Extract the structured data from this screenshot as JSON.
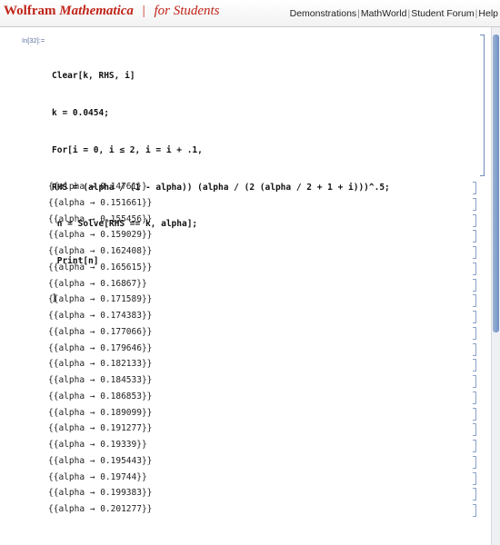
{
  "header": {
    "brand_wolfram": "Wolfram",
    "brand_mathematica": "Mathematica",
    "brand_divider": "|",
    "brand_students": "for Students",
    "links": [
      "Demonstrations",
      "MathWorld",
      "Student Forum",
      "Help"
    ]
  },
  "notebook": {
    "input_label": "In[32]:=",
    "code_lines": [
      "Clear[k, RHS, i]",
      "k = 0.0454;",
      "For[i = 0, i ≤ 2, i = i + .1,",
      "RHS = (alpha / (1 - alpha)) (alpha / (2 (alpha / 2 + 1 + i)))^.5;",
      " n = Solve[RHS == k, alpha];",
      " Print[n]",
      "]"
    ],
    "outputs": [
      "{{alpha → 0.14761}}",
      "{{alpha → 0.151661}}",
      "{{alpha → 0.155456}}",
      "{{alpha → 0.159029}}",
      "{{alpha → 0.162408}}",
      "{{alpha → 0.165615}}",
      "{{alpha → 0.16867}}",
      "{{alpha → 0.171589}}",
      "{{alpha → 0.174383}}",
      "{{alpha → 0.177066}}",
      "{{alpha → 0.179646}}",
      "{{alpha → 0.182133}}",
      "{{alpha → 0.184533}}",
      "{{alpha → 0.186853}}",
      "{{alpha → 0.189099}}",
      "{{alpha → 0.191277}}",
      "{{alpha → 0.19339}}",
      "{{alpha → 0.195443}}",
      "{{alpha → 0.19744}}",
      "{{alpha → 0.199383}}",
      "{{alpha → 0.201277}}"
    ]
  }
}
